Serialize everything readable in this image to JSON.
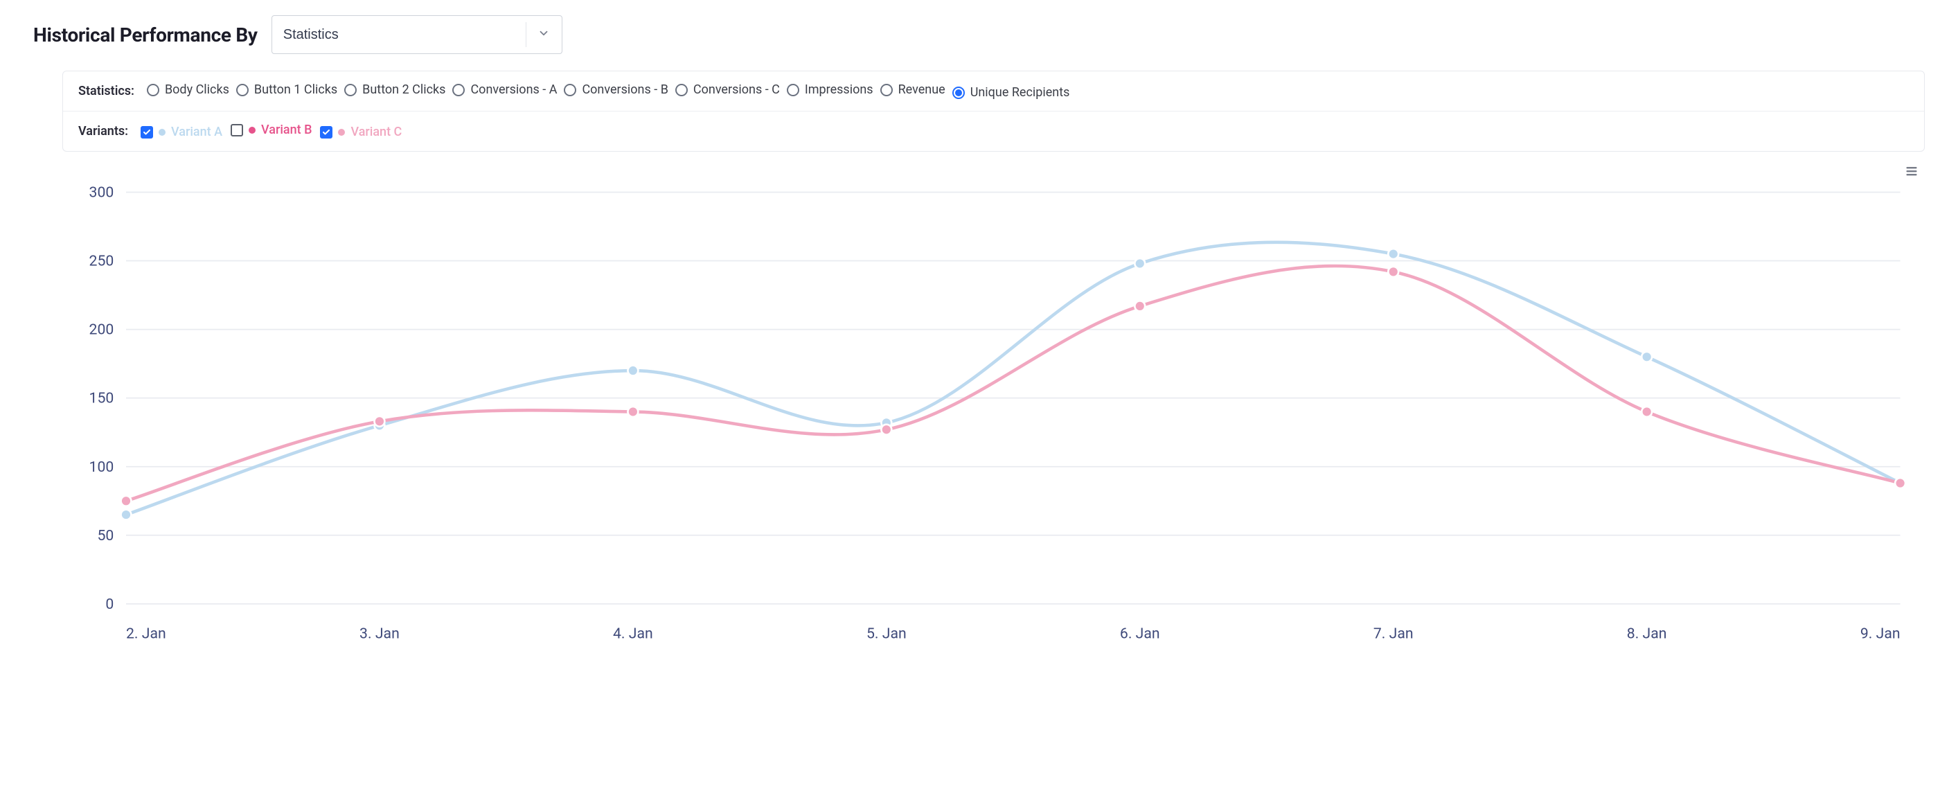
{
  "header": {
    "title": "Historical Performance By",
    "dropdown_value": "Statistics"
  },
  "filters": {
    "statistics_label": "Statistics:",
    "statistics_options": [
      {
        "label": "Body Clicks",
        "selected": false
      },
      {
        "label": "Button 1 Clicks",
        "selected": false
      },
      {
        "label": "Button 2 Clicks",
        "selected": false
      },
      {
        "label": "Conversions - A",
        "selected": false
      },
      {
        "label": "Conversions - B",
        "selected": false
      },
      {
        "label": "Conversions - C",
        "selected": false
      },
      {
        "label": "Impressions",
        "selected": false
      },
      {
        "label": "Revenue",
        "selected": false
      },
      {
        "label": "Unique Recipients",
        "selected": true
      }
    ],
    "variants_label": "Variants:",
    "variants": [
      {
        "label": "Variant A",
        "checked": true,
        "color": "#bcd9ef",
        "text_color": "#bcd9ef"
      },
      {
        "label": "Variant B",
        "checked": false,
        "color": "#e6538b",
        "text_color": "#e6538b"
      },
      {
        "label": "Variant C",
        "checked": true,
        "color": "#f1a7c0",
        "text_color": "#f1a7c0"
      }
    ]
  },
  "chart_data": {
    "type": "line",
    "xlabel": "",
    "ylabel": "",
    "ylim": [
      0,
      300
    ],
    "yticks": [
      0,
      50,
      100,
      150,
      200,
      250,
      300
    ],
    "categories": [
      "2. Jan",
      "3. Jan",
      "4. Jan",
      "5. Jan",
      "6. Jan",
      "7. Jan",
      "8. Jan",
      "9. Jan"
    ],
    "series": [
      {
        "name": "Variant A",
        "color": "#bcd9ef",
        "values": [
          65,
          130,
          170,
          132,
          248,
          255,
          180,
          88
        ]
      },
      {
        "name": "Variant C",
        "color": "#f1a7c0",
        "values": [
          75,
          133,
          140,
          127,
          217,
          242,
          140,
          88
        ]
      }
    ]
  }
}
